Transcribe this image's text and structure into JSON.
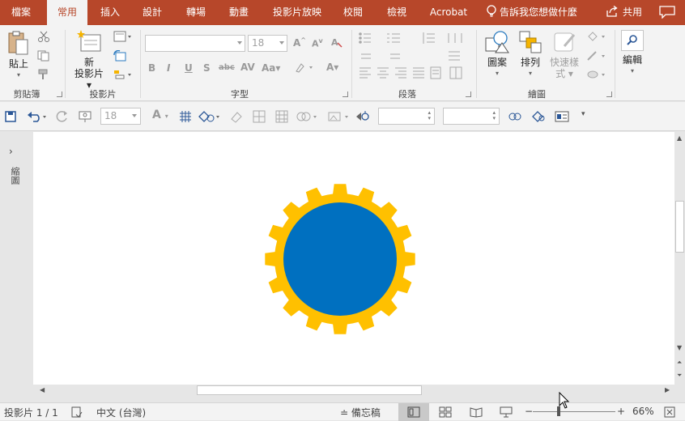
{
  "tabs": [
    {
      "label": "檔案",
      "active": false
    },
    {
      "label": "常用",
      "active": true
    },
    {
      "label": "插入",
      "active": false
    },
    {
      "label": "設計",
      "active": false
    },
    {
      "label": "轉場",
      "active": false
    },
    {
      "label": "動畫",
      "active": false
    },
    {
      "label": "投影片放映",
      "active": false
    },
    {
      "label": "校閱",
      "active": false
    },
    {
      "label": "檢視",
      "active": false
    },
    {
      "label": "Acrobat",
      "active": false
    }
  ],
  "tell_me": "告訴我您想做什麼",
  "share": "共用",
  "ribbon": {
    "clipboard": {
      "paste": "貼上",
      "group": "剪貼簿"
    },
    "slides": {
      "new_slide_1": "新",
      "new_slide_2": "投影片",
      "group": "投影片"
    },
    "font": {
      "font_name": "",
      "font_size": "18",
      "group": "字型"
    },
    "paragraph": {
      "group": "段落"
    },
    "drawing": {
      "shapes": "圖案",
      "arrange": "排列",
      "quick_styles_1": "快速樣",
      "quick_styles_2": "式",
      "group": "繪圖"
    },
    "editing": {
      "label": "編輯"
    }
  },
  "qat": {
    "font_size": "18",
    "width_value": "",
    "height_value": ""
  },
  "left_pane": {
    "label": "縮圖"
  },
  "status": {
    "slide_info": "投影片 1 / 1",
    "language": "中文 (台灣)",
    "notes": "備忘稿",
    "zoom": "66%"
  },
  "colors": {
    "tab_bar": "#b7472a",
    "gear_fill": "#ffc000",
    "circle_fill": "#0070c0"
  }
}
